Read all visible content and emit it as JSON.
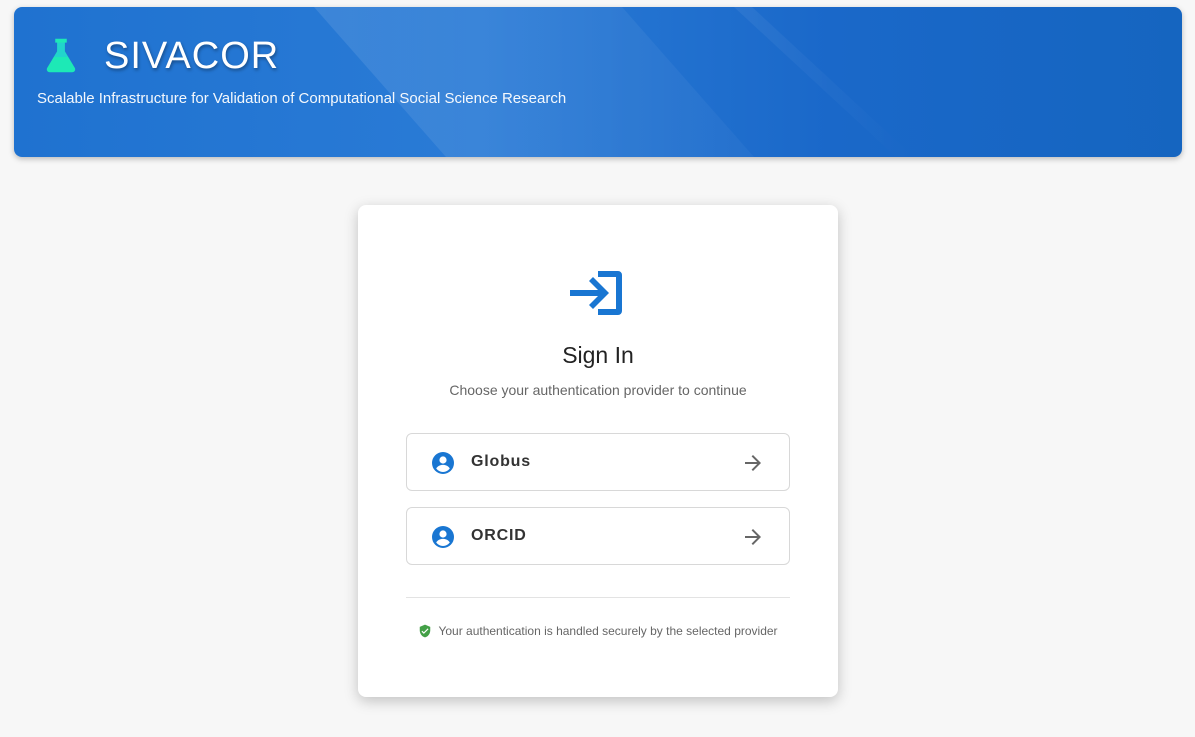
{
  "header": {
    "title": "SIVACOR",
    "subtitle": "Scalable Infrastructure for Validation of Computational Social Science Research",
    "logo_icon": "flask-icon"
  },
  "signin": {
    "icon": "login-icon",
    "title": "Sign In",
    "subtitle": "Choose your authentication provider to continue",
    "providers": [
      {
        "label": "Globus",
        "icon": "account-circle-icon",
        "action_icon": "arrow-right-icon"
      },
      {
        "label": "ORCID",
        "icon": "account-circle-icon",
        "action_icon": "arrow-right-icon"
      }
    ],
    "security_note": "Your authentication is handled securely by the selected provider",
    "security_icon": "shield-check-icon"
  },
  "colors": {
    "header_blue": "#1f72d0",
    "accent_blue": "#1976d2",
    "flask_teal": "#1de9b6",
    "shield_green": "#43a047",
    "background": "#f7f7f7"
  }
}
